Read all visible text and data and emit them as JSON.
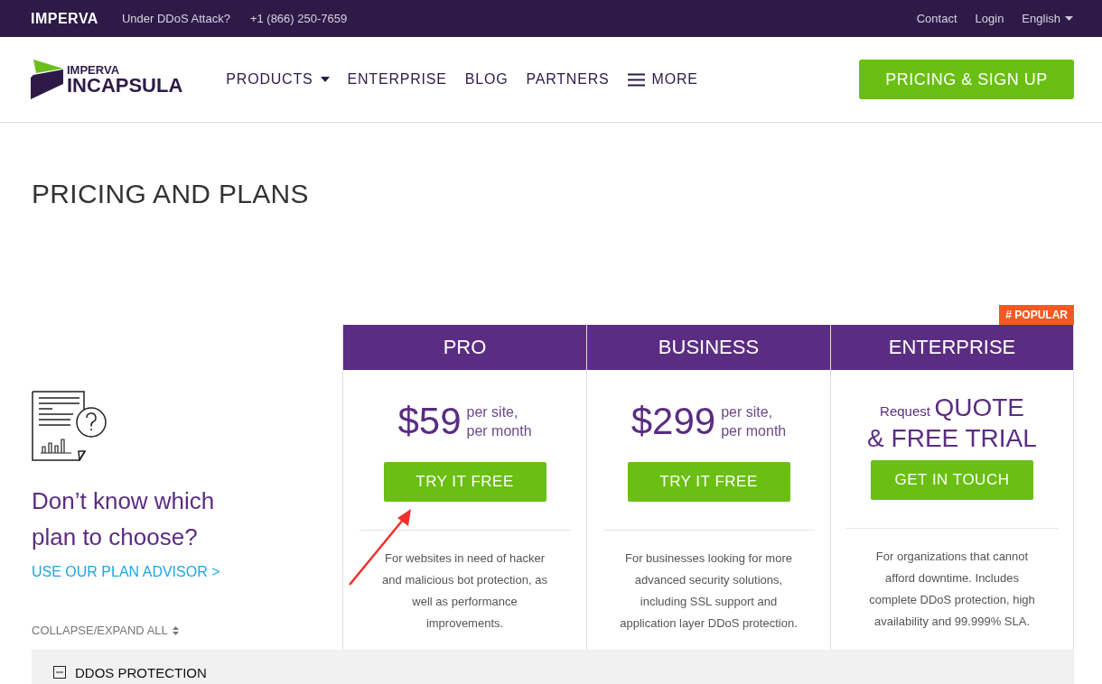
{
  "top_bar": {
    "brand": "IMPERVA",
    "attack_label": "Under DDoS Attack?",
    "phone": "+1 (866) 250-7659",
    "links": [
      "Contact",
      "Login"
    ],
    "language": "English"
  },
  "header": {
    "logo_top": "IMPERVA",
    "logo_bottom": "INCAPSULA",
    "nav": [
      {
        "label": "PRODUCTS",
        "kind": "dropdown"
      },
      {
        "label": "ENTERPRISE",
        "kind": "link"
      },
      {
        "label": "BLOG",
        "kind": "link"
      },
      {
        "label": "PARTNERS",
        "kind": "link"
      },
      {
        "label": "MORE",
        "kind": "menu"
      }
    ],
    "cta": "PRICING & SIGN UP"
  },
  "page_title": "PRICING AND PLANS",
  "advisor": {
    "heading": "Don’t know which plan to choose?",
    "link": "USE OUR PLAN ADVISOR >",
    "collapse": "COLLAPSE/EXPAND ALL"
  },
  "badge": "# POPULAR",
  "plans": [
    {
      "name": "PRO",
      "kind": "price",
      "price": "$59",
      "unit": [
        "per site,",
        "per month"
      ],
      "button": "TRY IT FREE",
      "description": "For websites in need of hacker and malicious bot protection, as well as performance improvements."
    },
    {
      "name": "BUSINESS",
      "kind": "price",
      "price": "$299",
      "unit": [
        "per site,",
        "per month"
      ],
      "button": "TRY IT FREE",
      "description": "For businesses looking for more advanced security solutions, including SSL support and application layer DDoS protection."
    },
    {
      "name": "ENTERPRISE",
      "kind": "quote",
      "prefix": "Request",
      "price": "QUOTE",
      "line2": "& FREE TRIAL",
      "button": "GET IN TOUCH",
      "description": "For organizations that cannot afford downtime. Includes complete DDoS protection, high availability and 99.999% SLA."
    }
  ],
  "section": {
    "title": "DDOS PROTECTION",
    "expanded": true
  }
}
